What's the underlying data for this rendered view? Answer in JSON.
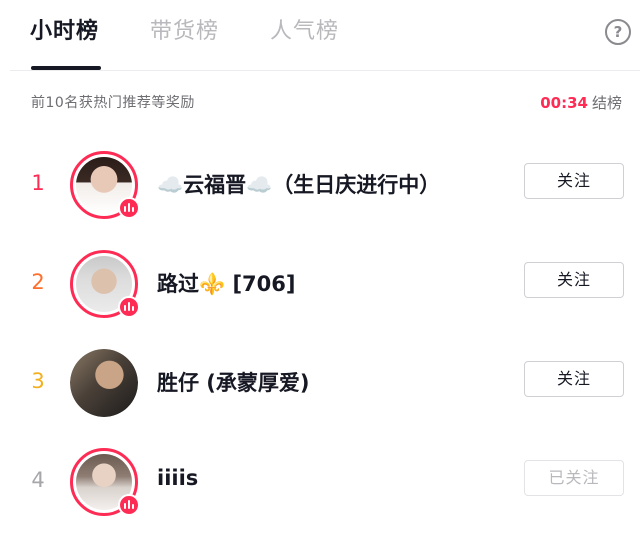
{
  "tabs": [
    {
      "label": "小时榜",
      "active": true
    },
    {
      "label": "带货榜",
      "active": false
    },
    {
      "label": "人气榜",
      "active": false
    }
  ],
  "help_icon": "question-circle-icon",
  "subtitle": "前10名获热门推荐等奖励",
  "countdown": {
    "time": "00:34",
    "label": "结榜"
  },
  "colors": {
    "accent": "#fe2c55",
    "rank1": "#fe2c55",
    "rank2": "#ff6e2b",
    "rank3": "#f2b01e",
    "rank_other": "#a5a5aa"
  },
  "rankings": [
    {
      "rank": "1",
      "name": "☁️云福晋☁️（生日庆进行中）",
      "live": true,
      "follow_label": "关注",
      "followed": false
    },
    {
      "rank": "2",
      "name": "路过⚜️ [706]",
      "live": true,
      "follow_label": "关注",
      "followed": false
    },
    {
      "rank": "3",
      "name": "胜仔 (承蒙厚爱)",
      "live": false,
      "follow_label": "关注",
      "followed": false
    },
    {
      "rank": "4",
      "name": "iiiis",
      "live": true,
      "follow_label": "已关注",
      "followed": true
    }
  ]
}
